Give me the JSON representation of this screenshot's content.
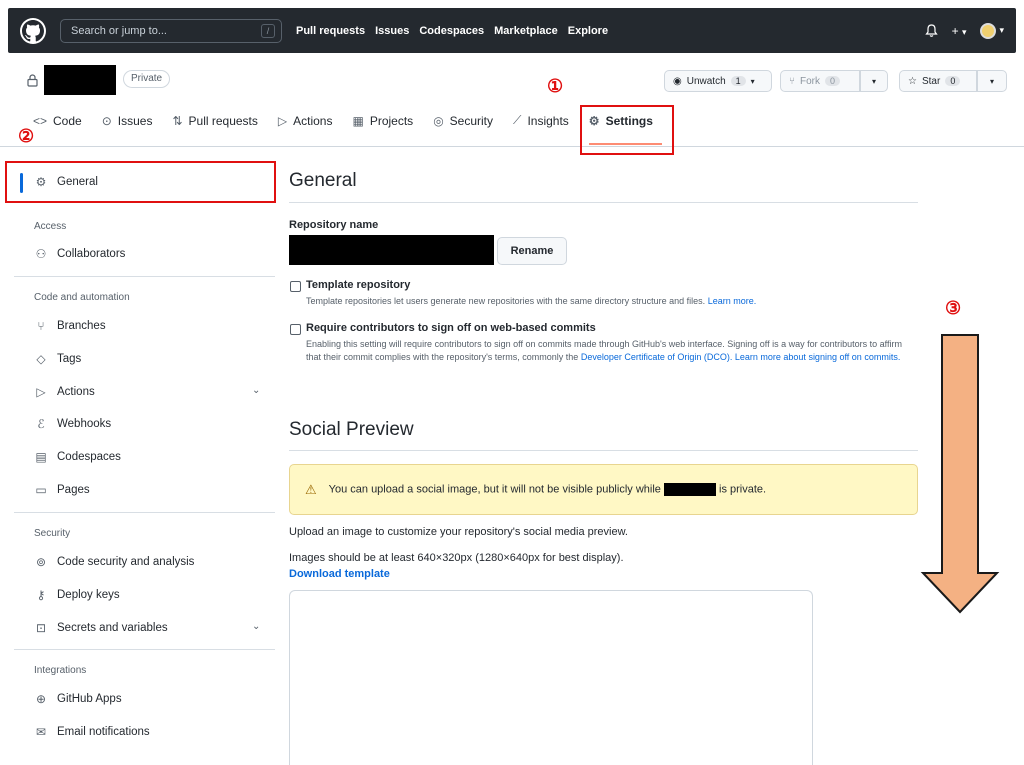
{
  "header": {
    "search_placeholder": "Search or jump to...",
    "search_shortcut": "/",
    "nav": [
      "Pull requests",
      "Issues",
      "Codespaces",
      "Marketplace",
      "Explore"
    ],
    "bell_icon": "🔔",
    "plus_label": "+",
    "caret": "▾"
  },
  "repo": {
    "visibility": "Private",
    "watch_label": "Unwatch",
    "watch_count": "1",
    "fork_label": "Fork",
    "fork_count": "0",
    "star_label": "Star",
    "star_count": "0"
  },
  "tabs": [
    {
      "label": "Code",
      "icon": "<>"
    },
    {
      "label": "Issues",
      "icon": "⊙"
    },
    {
      "label": "Pull requests",
      "icon": "⇅"
    },
    {
      "label": "Actions",
      "icon": "▷"
    },
    {
      "label": "Projects",
      "icon": "▦"
    },
    {
      "label": "Security",
      "icon": "◎"
    },
    {
      "label": "Insights",
      "icon": "⟋"
    },
    {
      "label": "Settings",
      "icon": "⚙"
    }
  ],
  "annotations": {
    "one": "①",
    "two": "②",
    "three": "③"
  },
  "sidebar": {
    "general": "General",
    "access_head": "Access",
    "collaborators": "Collaborators",
    "code_head": "Code and automation",
    "branches": "Branches",
    "tags": "Tags",
    "actions": "Actions",
    "webhooks": "Webhooks",
    "codespaces": "Codespaces",
    "pages": "Pages",
    "security_head": "Security",
    "code_security": "Code security and analysis",
    "deploy_keys": "Deploy keys",
    "secrets": "Secrets and variables",
    "integrations_head": "Integrations",
    "github_apps": "GitHub Apps",
    "email_notifications": "Email notifications"
  },
  "main": {
    "general_title": "General",
    "repo_name_label": "Repository name",
    "rename_button": "Rename",
    "template_title": "Template repository",
    "template_desc": "Template repositories let users generate new repositories with the same directory structure and files.",
    "learn_more": "Learn more.",
    "signoff_title": "Require contributors to sign off on web-based commits",
    "signoff_desc": "Enabling this setting will require contributors to sign off on commits made through GitHub's web interface. Signing off is a way for contributors to affirm that their commit complies with the repository's terms, commonly the",
    "dco_link": "Developer Certificate of Origin (DCO).",
    "signoff_link": "Learn more about signing off on commits.",
    "social_title": "Social Preview",
    "warn_text_1": "You can upload a social image, but it will not be visible publicly while",
    "warn_text_2": "is private.",
    "upload_text": "Upload an image to customize your repository's social media preview.",
    "size_text": "Images should be at least 640×320px (1280×640px for best display).",
    "download_template": "Download template"
  },
  "colors": {
    "accent": "#0969da",
    "annotation_red": "#e01010",
    "arrow_fill": "#f4b183",
    "underline": "#fd8c73"
  }
}
